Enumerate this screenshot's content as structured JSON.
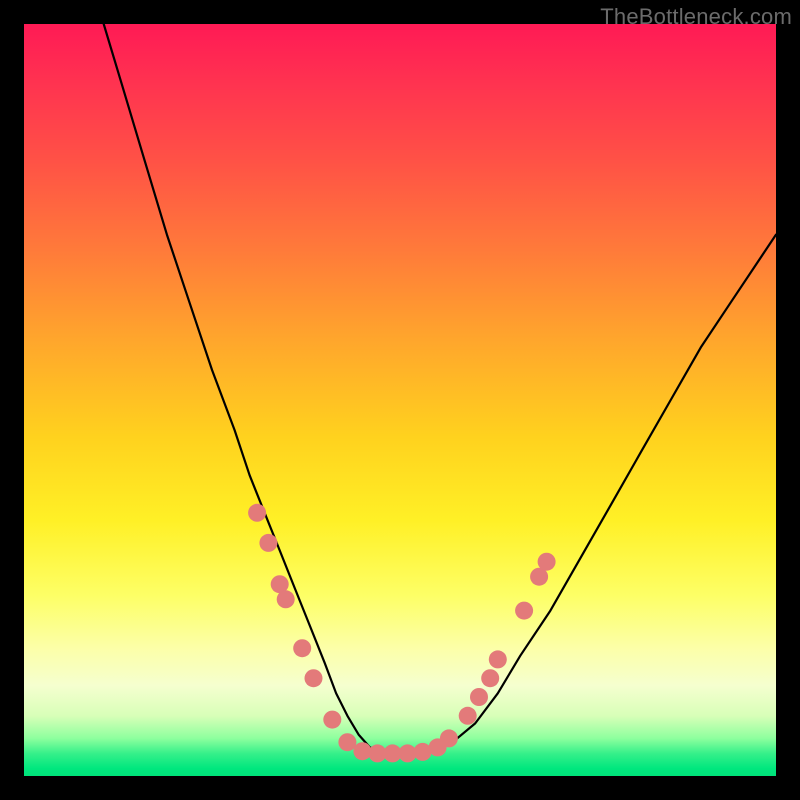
{
  "watermark": "TheBottleneck.com",
  "colors": {
    "dot": "#e37a7a",
    "curve": "#000000",
    "gradient_top": "#ff1a55",
    "gradient_bottom": "#00e27a"
  },
  "chart_data": {
    "type": "line",
    "title": "",
    "xlabel": "",
    "ylabel": "",
    "xlim": [
      0,
      100
    ],
    "ylim": [
      0,
      100
    ],
    "note": "x and y in plot-fraction units (0–100). y=0 is bottom (green), y=100 is top (red). Curve is the black V-shape; markers are the salmon dots on/near the curve.",
    "series": [
      {
        "name": "bottleneck-curve",
        "x": [
          10.6,
          13,
          16,
          19,
          22,
          25,
          28,
          30,
          32,
          34,
          36,
          38,
          40,
          41.5,
          43,
          44.5,
          46,
          48,
          51,
          54,
          57,
          60,
          63,
          66,
          70,
          74,
          78,
          82,
          86,
          90,
          94,
          98,
          100
        ],
        "y": [
          100,
          92,
          82,
          72,
          63,
          54,
          46,
          40,
          35,
          30,
          25,
          20,
          15,
          11,
          8,
          5.5,
          3.8,
          3.0,
          3.0,
          3.3,
          4.5,
          7,
          11,
          16,
          22,
          29,
          36,
          43,
          50,
          57,
          63,
          69,
          72
        ]
      }
    ],
    "markers": [
      {
        "x": 31.0,
        "y": 35.0
      },
      {
        "x": 32.5,
        "y": 31.0
      },
      {
        "x": 34.0,
        "y": 25.5
      },
      {
        "x": 34.8,
        "y": 23.5
      },
      {
        "x": 37.0,
        "y": 17.0
      },
      {
        "x": 38.5,
        "y": 13.0
      },
      {
        "x": 41.0,
        "y": 7.5
      },
      {
        "x": 43.0,
        "y": 4.5
      },
      {
        "x": 45.0,
        "y": 3.3
      },
      {
        "x": 47.0,
        "y": 3.0
      },
      {
        "x": 49.0,
        "y": 3.0
      },
      {
        "x": 51.0,
        "y": 3.0
      },
      {
        "x": 53.0,
        "y": 3.2
      },
      {
        "x": 55.0,
        "y": 3.8
      },
      {
        "x": 56.5,
        "y": 5.0
      },
      {
        "x": 59.0,
        "y": 8.0
      },
      {
        "x": 60.5,
        "y": 10.5
      },
      {
        "x": 62.0,
        "y": 13.0
      },
      {
        "x": 63.0,
        "y": 15.5
      },
      {
        "x": 66.5,
        "y": 22.0
      },
      {
        "x": 68.5,
        "y": 26.5
      },
      {
        "x": 69.5,
        "y": 28.5
      }
    ]
  }
}
